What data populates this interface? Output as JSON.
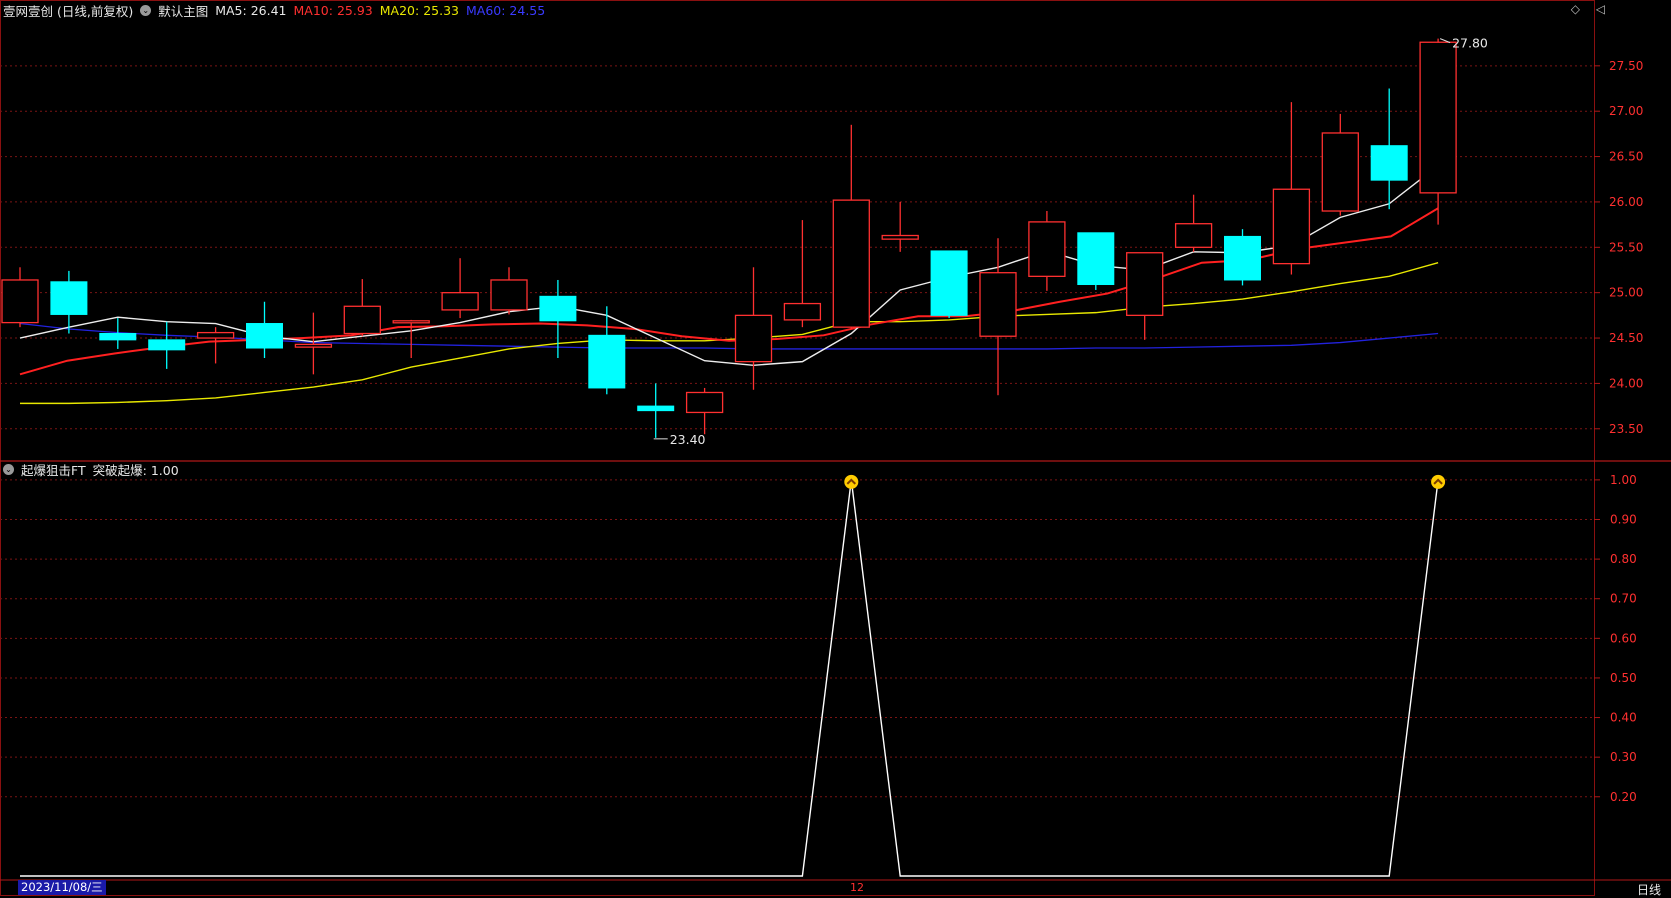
{
  "header": {
    "title": "壹网壹创 (日线,前复权)",
    "main_label": "默认主图",
    "ma5": {
      "label": "MA5:",
      "value": "26.41",
      "color": "#e8e8e8"
    },
    "ma10": {
      "label": "MA10:",
      "value": "25.93",
      "color": "#ff3030"
    },
    "ma20": {
      "label": "MA20:",
      "value": "25.33",
      "color": "#e8e800"
    },
    "ma60": {
      "label": "MA60:",
      "value": "24.55",
      "color": "#2222dd"
    }
  },
  "top_icons": "◇ ◁",
  "sub_header": {
    "title": "起爆狙击FT",
    "label": "突破起爆:",
    "value": "1.00"
  },
  "footer": {
    "date": "2023/11/08/三",
    "month_marker": "12",
    "period": "日线"
  },
  "annotations": {
    "high": "27.80",
    "low": "23.40"
  },
  "chart_data": [
    {
      "type": "candlestick",
      "y_ticks": [
        "27.50",
        "27.00",
        "26.50",
        "26.00",
        "25.50",
        "25.00",
        "24.50",
        "24.00",
        "23.50"
      ],
      "ylim": [
        23.2,
        27.95
      ],
      "up_color": "#ff3030",
      "down_color": "#00ffff",
      "candles": [
        {
          "o": 24.67,
          "h": 25.28,
          "l": 24.62,
          "c": 25.14
        },
        {
          "o": 25.12,
          "h": 25.24,
          "l": 24.55,
          "c": 24.76
        },
        {
          "o": 24.55,
          "h": 24.72,
          "l": 24.38,
          "c": 24.48
        },
        {
          "o": 24.48,
          "h": 24.68,
          "l": 24.16,
          "c": 24.37
        },
        {
          "o": 24.5,
          "h": 24.62,
          "l": 24.22,
          "c": 24.56
        },
        {
          "o": 24.66,
          "h": 24.9,
          "l": 24.28,
          "c": 24.39
        },
        {
          "o": 24.4,
          "h": 24.78,
          "l": 24.1,
          "c": 24.43
        },
        {
          "o": 24.55,
          "h": 25.15,
          "l": 24.52,
          "c": 24.85
        },
        {
          "o": 24.67,
          "h": 24.7,
          "l": 24.28,
          "c": 24.69
        },
        {
          "o": 24.81,
          "h": 25.38,
          "l": 24.72,
          "c": 25.0
        },
        {
          "o": 24.81,
          "h": 25.28,
          "l": 24.76,
          "c": 25.14
        },
        {
          "o": 24.96,
          "h": 25.14,
          "l": 24.28,
          "c": 24.69
        },
        {
          "o": 24.53,
          "h": 24.85,
          "l": 23.88,
          "c": 23.95
        },
        {
          "o": 23.75,
          "h": 24.0,
          "l": 23.4,
          "c": 23.7
        },
        {
          "o": 23.68,
          "h": 23.95,
          "l": 23.44,
          "c": 23.9
        },
        {
          "o": 24.24,
          "h": 25.28,
          "l": 23.93,
          "c": 24.75
        },
        {
          "o": 24.7,
          "h": 25.8,
          "l": 24.62,
          "c": 24.88
        },
        {
          "o": 24.62,
          "h": 26.85,
          "l": 24.6,
          "c": 26.02
        },
        {
          "o": 25.59,
          "h": 26.0,
          "l": 25.45,
          "c": 25.63
        },
        {
          "o": 25.46,
          "h": 25.46,
          "l": 24.72,
          "c": 24.75
        },
        {
          "o": 24.52,
          "h": 25.6,
          "l": 23.87,
          "c": 25.22
        },
        {
          "o": 25.18,
          "h": 25.9,
          "l": 25.02,
          "c": 25.78
        },
        {
          "o": 25.66,
          "h": 25.66,
          "l": 25.03,
          "c": 25.09
        },
        {
          "o": 24.75,
          "h": 25.44,
          "l": 24.48,
          "c": 25.44
        },
        {
          "o": 25.5,
          "h": 26.08,
          "l": 25.45,
          "c": 25.76
        },
        {
          "o": 25.62,
          "h": 25.7,
          "l": 25.08,
          "c": 25.14
        },
        {
          "o": 25.32,
          "h": 27.1,
          "l": 25.2,
          "c": 26.14
        },
        {
          "o": 25.9,
          "h": 26.97,
          "l": 25.85,
          "c": 26.76
        },
        {
          "o": 26.62,
          "h": 27.25,
          "l": 25.92,
          "c": 26.24
        },
        {
          "o": 26.1,
          "h": 27.8,
          "l": 25.75,
          "c": 27.76
        }
      ],
      "ma5": [
        24.5,
        24.62,
        24.73,
        24.68,
        24.66,
        24.52,
        24.46,
        24.52,
        24.58,
        24.67,
        24.79,
        24.85,
        24.75,
        24.5,
        24.25,
        24.2,
        24.24,
        24.55,
        25.03,
        25.17,
        25.28,
        25.46,
        25.3,
        25.25,
        25.45,
        25.44,
        25.52,
        25.83,
        25.98,
        26.4
      ],
      "ma10": [
        24.1,
        24.25,
        24.33,
        24.4,
        24.46,
        24.48,
        24.5,
        24.53,
        24.62,
        24.63,
        24.65,
        24.66,
        24.64,
        24.6,
        24.52,
        24.47,
        24.49,
        24.53,
        24.65,
        24.74,
        24.74,
        24.8,
        24.9,
        24.99,
        25.15,
        25.33,
        25.36,
        25.48,
        25.55,
        25.62,
        25.93
      ],
      "ma20": [
        23.78,
        23.78,
        23.79,
        23.81,
        23.84,
        23.9,
        23.96,
        24.04,
        24.18,
        24.28,
        24.38,
        24.44,
        24.48,
        24.47,
        24.47,
        24.5,
        24.54,
        24.68,
        24.68,
        24.7,
        24.74,
        24.76,
        24.78,
        24.84,
        24.88,
        24.93,
        25.01,
        25.1,
        25.18,
        25.33
      ],
      "ma60": [
        24.66,
        24.6,
        24.56,
        24.53,
        24.51,
        24.48,
        24.45,
        24.44,
        24.43,
        24.42,
        24.41,
        24.4,
        24.39,
        24.39,
        24.39,
        24.38,
        24.38,
        24.38,
        24.38,
        24.38,
        24.38,
        24.38,
        24.39,
        24.39,
        24.4,
        24.41,
        24.42,
        24.45,
        24.5,
        24.55
      ]
    },
    {
      "type": "line",
      "title": "起爆狙击FT",
      "series": [
        {
          "name": "突破起爆",
          "values": [
            0,
            0,
            0,
            0,
            0,
            0,
            0,
            0,
            0,
            0,
            0,
            0,
            0,
            0,
            0,
            0,
            0,
            1,
            0,
            0,
            0,
            0,
            0,
            0,
            0,
            0,
            0,
            0,
            0,
            1
          ]
        }
      ],
      "y_ticks": [
        "1.00",
        "0.90",
        "0.80",
        "0.70",
        "0.60",
        "0.50",
        "0.40",
        "0.30",
        "0.20"
      ],
      "ylim": [
        0,
        1.03
      ],
      "line_color": "#ffffff",
      "signal_color": "#ffcc00",
      "grid": true
    }
  ]
}
